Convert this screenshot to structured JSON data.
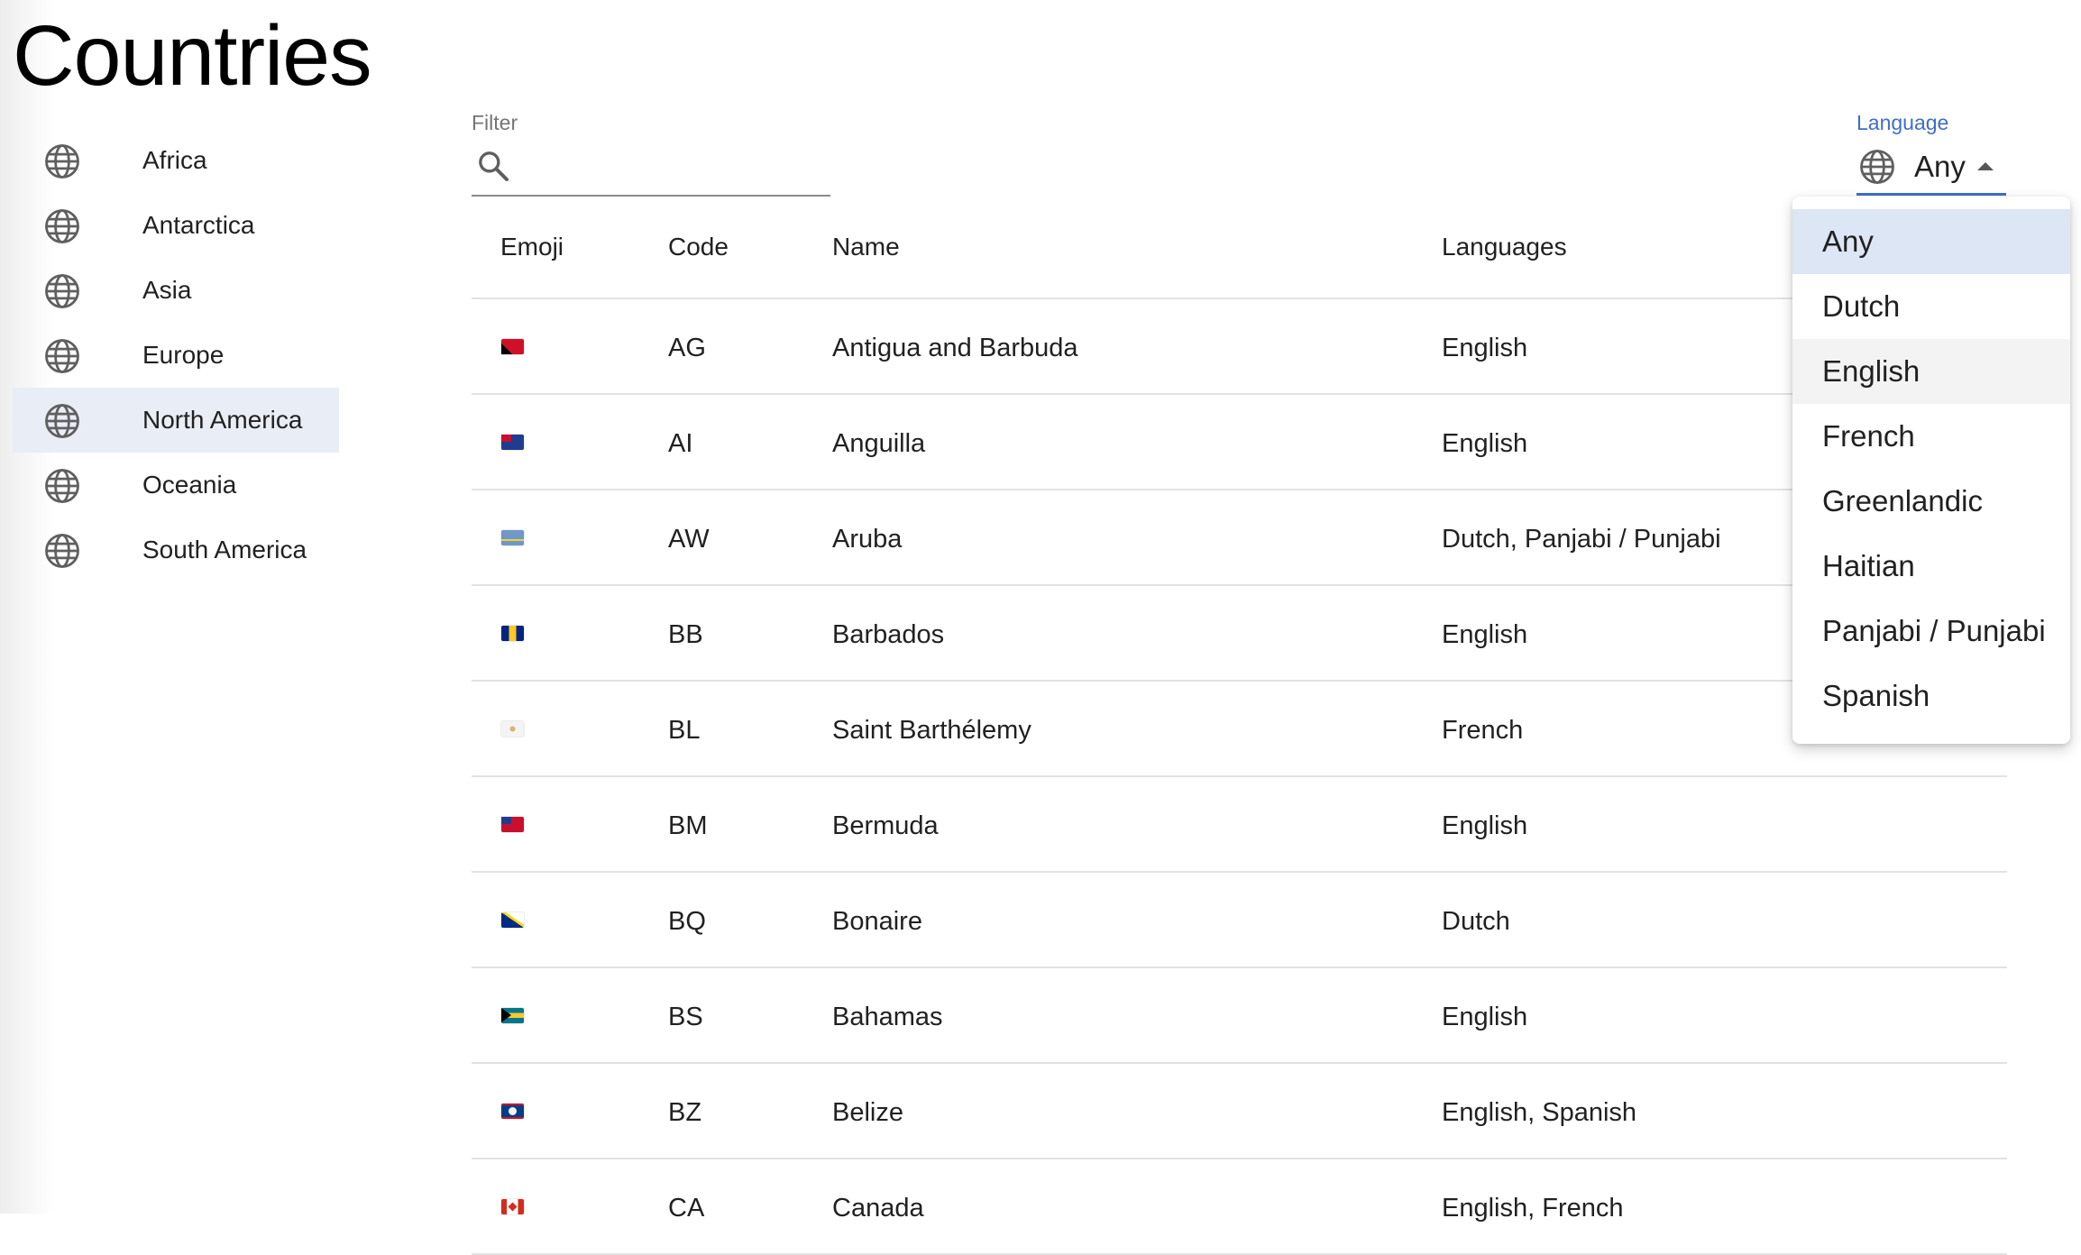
{
  "page": {
    "title": "Countries"
  },
  "sidebar": {
    "items": [
      {
        "label": "Africa",
        "icon": "globe-icon"
      },
      {
        "label": "Antarctica",
        "icon": "globe-icon"
      },
      {
        "label": "Asia",
        "icon": "globe-icon"
      },
      {
        "label": "Europe",
        "icon": "globe-icon"
      },
      {
        "label": "North America",
        "icon": "globe-icon",
        "selected": true
      },
      {
        "label": "Oceania",
        "icon": "globe-icon"
      },
      {
        "label": "South America",
        "icon": "globe-icon"
      }
    ]
  },
  "filter": {
    "label": "Filter",
    "value": "",
    "placeholder": "",
    "icon": "search-icon"
  },
  "language_select": {
    "label": "Language",
    "value": "Any",
    "icon": "globe-icon",
    "options": [
      "Any",
      "Dutch",
      "English",
      "French",
      "Greenlandic",
      "Haitian",
      "Panjabi / Punjabi",
      "Spanish"
    ],
    "hovered": "English"
  },
  "table": {
    "headers": {
      "emoji": "Emoji",
      "code": "Code",
      "name": "Name",
      "languages": "Languages"
    },
    "rows": [
      {
        "code": "AG",
        "name": "Antigua and Barbuda",
        "languages": "English"
      },
      {
        "code": "AI",
        "name": "Anguilla",
        "languages": "English"
      },
      {
        "code": "AW",
        "name": "Aruba",
        "languages": "Dutch, Panjabi / Punjabi"
      },
      {
        "code": "BB",
        "name": "Barbados",
        "languages": "English"
      },
      {
        "code": "BL",
        "name": "Saint Barthélemy",
        "languages": "French"
      },
      {
        "code": "BM",
        "name": "Bermuda",
        "languages": "English"
      },
      {
        "code": "BQ",
        "name": "Bonaire",
        "languages": "Dutch"
      },
      {
        "code": "BS",
        "name": "Bahamas",
        "languages": "English"
      },
      {
        "code": "BZ",
        "name": "Belize",
        "languages": "English, Spanish"
      },
      {
        "code": "CA",
        "name": "Canada",
        "languages": "English, French"
      }
    ]
  },
  "colors": {
    "accent": "#3f6ec7",
    "selected_bg": "#e8edf6",
    "divider": "#e2e2e2"
  }
}
